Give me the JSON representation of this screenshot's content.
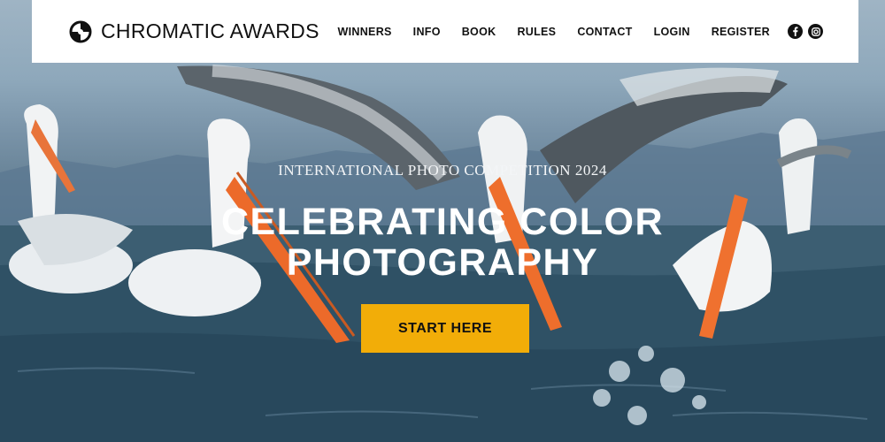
{
  "brand": {
    "name": "CHROMATIC AWARDS"
  },
  "nav": {
    "items": [
      {
        "label": "WINNERS"
      },
      {
        "label": "INFO"
      },
      {
        "label": "BOOK"
      },
      {
        "label": "RULES"
      },
      {
        "label": "CONTACT"
      },
      {
        "label": "LOGIN"
      },
      {
        "label": "REGISTER"
      }
    ],
    "social": [
      "facebook-icon",
      "instagram-icon"
    ]
  },
  "hero": {
    "kicker": "INTERNATIONAL PHOTO COMPETITION 2024",
    "headline_line1": "CELEBRATING COLOR",
    "headline_line2": "PHOTOGRAPHY",
    "cta_label": "START HERE"
  },
  "colors": {
    "accent": "#f2ad08",
    "nav_bg": "#ffffff",
    "text_dark": "#111111"
  }
}
